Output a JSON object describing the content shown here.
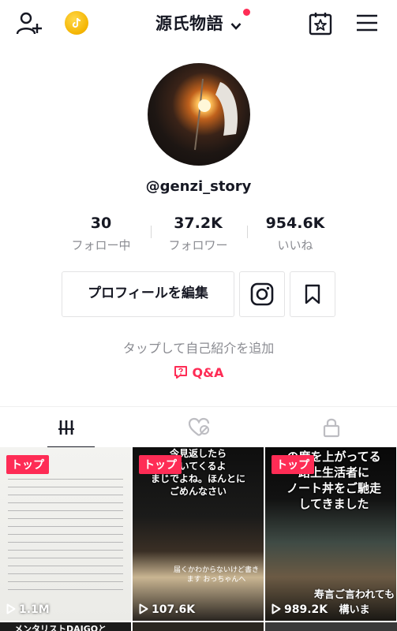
{
  "header": {
    "title": "源氏物語",
    "add_user_icon": "add-user-icon",
    "coin_icon": "tiktok-coin-icon",
    "calendar_icon": "calendar-star-icon",
    "menu_icon": "hamburger-menu-icon",
    "notification_dot_color": "#fe2c55"
  },
  "profile": {
    "username": "@genzi_story",
    "stats": [
      {
        "value": "30",
        "label": "フォロー中"
      },
      {
        "value": "37.2K",
        "label": "フォロワー"
      },
      {
        "value": "954.6K",
        "label": "いいね"
      }
    ],
    "edit_label": "プロフィールを編集",
    "add_bio": "タップして自己紹介を追加",
    "qa_label": "Q&A"
  },
  "tabs": [
    {
      "name": "videos",
      "icon": "grid-icon",
      "active": true
    },
    {
      "name": "liked",
      "icon": "liked-hidden-icon",
      "active": false
    },
    {
      "name": "private",
      "icon": "lock-icon",
      "active": false
    }
  ],
  "videos": [
    {
      "badge": "トップ",
      "views": "1.1M",
      "overlay": ""
    },
    {
      "badge": "トップ",
      "views": "107.6K",
      "overlay": "今見返したら\n泣いてくるよ\nまじでよね。ほんとに\nごめんなさい",
      "caption": "届くかわからないけど書きます おっちゃんへ"
    },
    {
      "badge": "トップ",
      "views": "989.2K",
      "overlay": "の度を上がってる\n路上生活者に\nノート丼をご馳走\nしてきました",
      "caption": "寿言ご言われても構いま"
    }
  ],
  "bottom_peek": {
    "text": "メンタリストDAIGOと"
  },
  "colors": {
    "accent": "#fe2c55",
    "text": "#161823",
    "muted": "#8a8b91"
  }
}
